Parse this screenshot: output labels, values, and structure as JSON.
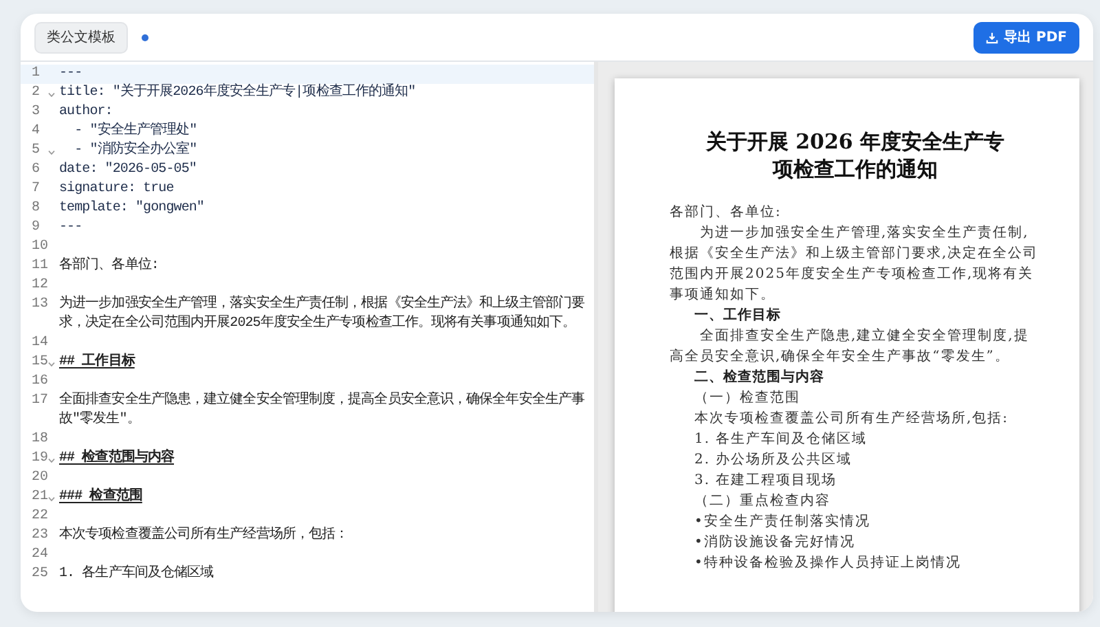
{
  "toolbar": {
    "template_button": "类公文模板",
    "modified": true,
    "export_button": "导出 PDF"
  },
  "editor": {
    "lines": [
      {
        "number": "1",
        "text": "---",
        "kind": "yaml",
        "current": true,
        "foldable": false
      },
      {
        "number": "2",
        "text": "title: \"关于开展2026年度安全生产专|项检查工作的通知\"",
        "kind": "yaml",
        "current": false,
        "foldable": true
      },
      {
        "number": "3",
        "text": "author:",
        "kind": "yaml",
        "current": false,
        "foldable": false
      },
      {
        "number": "4",
        "text": "  - \"安全生产管理处\"",
        "kind": "yaml",
        "current": false,
        "foldable": false
      },
      {
        "number": "5",
        "text": "  - \"消防安全办公室\"",
        "kind": "yaml",
        "current": false,
        "foldable": true
      },
      {
        "number": "6",
        "text": "date: \"2026-05-05\"",
        "kind": "yaml",
        "current": false,
        "foldable": false
      },
      {
        "number": "7",
        "text": "signature: true",
        "kind": "yaml",
        "current": false,
        "foldable": false
      },
      {
        "number": "8",
        "text": "template: \"gongwen\"",
        "kind": "yaml",
        "current": false,
        "foldable": false
      },
      {
        "number": "9",
        "text": "---",
        "kind": "yaml",
        "current": false,
        "foldable": false
      },
      {
        "number": "10",
        "kind": "text",
        "current": false,
        "foldable": false
      },
      {
        "number": "11",
        "text": "各部门、各单位:",
        "kind": "text",
        "current": false,
        "foldable": false
      },
      {
        "number": "12",
        "kind": "text",
        "current": false,
        "foldable": false
      },
      {
        "number": "13",
        "text": "为进一步加强安全生产管理，落实安全生产责任制，根据《安全生产法》和上级主管部门要求，决定在全公司范围内开展2025年度安全生产专项检查工作。现将有关事项通知如下。",
        "kind": "text",
        "current": false,
        "foldable": false
      },
      {
        "number": "14",
        "kind": "text",
        "current": false,
        "foldable": false
      },
      {
        "number": "15",
        "text": "## 工作目标",
        "kind": "heading",
        "current": false,
        "foldable": true
      },
      {
        "number": "16",
        "kind": "text",
        "current": false,
        "foldable": false
      },
      {
        "number": "17",
        "text": "全面排查安全生产隐患，建立健全安全管理制度，提高全员安全意识，确保全年安全生产事故\"零发生\"。",
        "kind": "text",
        "current": false,
        "foldable": false
      },
      {
        "number": "18",
        "kind": "text",
        "current": false,
        "foldable": false
      },
      {
        "number": "19",
        "text": "## 检查范围与内容",
        "kind": "heading",
        "current": false,
        "foldable": true
      },
      {
        "number": "20",
        "kind": "text",
        "current": false,
        "foldable": false
      },
      {
        "number": "21",
        "text": "### 检查范围",
        "kind": "heading",
        "current": false,
        "foldable": true
      },
      {
        "number": "22",
        "kind": "text",
        "current": false,
        "foldable": false
      },
      {
        "number": "23",
        "text": "本次专项检查覆盖公司所有生产经营场所，包括：",
        "kind": "text",
        "current": false,
        "foldable": false
      },
      {
        "number": "24",
        "kind": "text",
        "current": false,
        "foldable": false
      },
      {
        "number": "25",
        "text": "1. 各生产车间及仓储区域",
        "kind": "text",
        "current": false,
        "foldable": false
      }
    ]
  },
  "preview": {
    "title_lines": [
      "关于开展 2026 年度安全生产专",
      "项检查工作的通知"
    ],
    "blocks": [
      {
        "kind": "plain",
        "text": "各部门、各单位:"
      },
      {
        "kind": "paragraph",
        "text": "为进一步加强安全生产管理,落实安全生产责任制,根据《安全生产法》和上级主管部门要求,决定在全公司范围内开展2025年度安全生产专项检查工作,现将有关事项通知如下。"
      },
      {
        "kind": "heading",
        "text": "一、工作目标"
      },
      {
        "kind": "paragraph",
        "text": "全面排查安全生产隐患,建立健全安全管理制度,提高全员安全意识,确保全年安全生产事故“零发生”。"
      },
      {
        "kind": "heading",
        "text": "二、检查范围与内容"
      },
      {
        "kind": "item",
        "text": "（一）检查范围"
      },
      {
        "kind": "item",
        "text": "本次专项检查覆盖公司所有生产经营场所,包括:"
      },
      {
        "kind": "item",
        "text": "1. 各生产车间及仓储区域"
      },
      {
        "kind": "item",
        "text": "2. 办公场所及公共区域"
      },
      {
        "kind": "item",
        "text": "3. 在建工程项目现场"
      },
      {
        "kind": "item",
        "text": "（二）重点检查内容"
      },
      {
        "kind": "item",
        "text": "•安全生产责任制落实情况"
      },
      {
        "kind": "item",
        "text": "•消防设施设备完好情况"
      },
      {
        "kind": "item",
        "text": "•特种设备检验及操作人员持证上岗情况"
      }
    ]
  }
}
